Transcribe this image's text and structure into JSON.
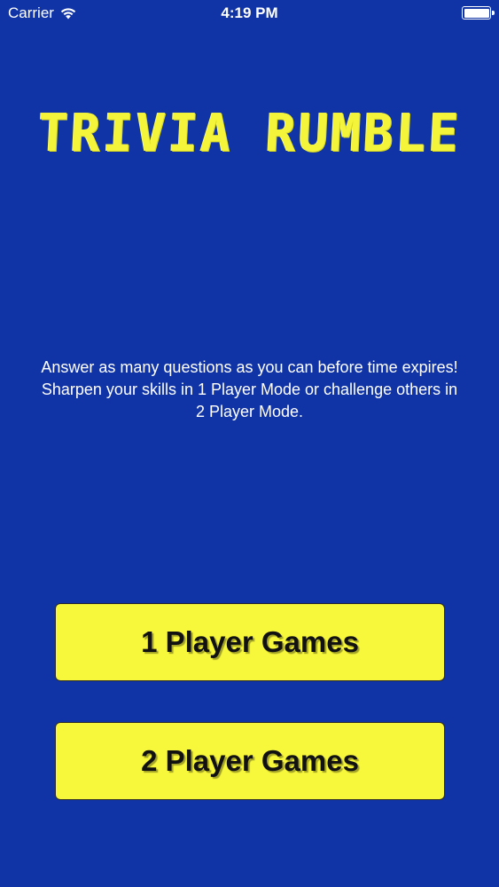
{
  "status_bar": {
    "carrier": "Carrier",
    "time": "4:19 PM",
    "wifi_icon": "wifi-icon",
    "battery_icon": "battery-icon"
  },
  "title": "TRIVIA RUMBLE",
  "description": "Answer as many questions as you can before time expires! Sharpen your skills in 1 Player Mode or challenge others in 2 Player Mode.",
  "buttons": {
    "one_player": "1 Player Games",
    "two_player": "2 Player Games"
  },
  "colors": {
    "background": "#1034a6",
    "title": "#f4f43a",
    "button": "#f7f73b"
  }
}
